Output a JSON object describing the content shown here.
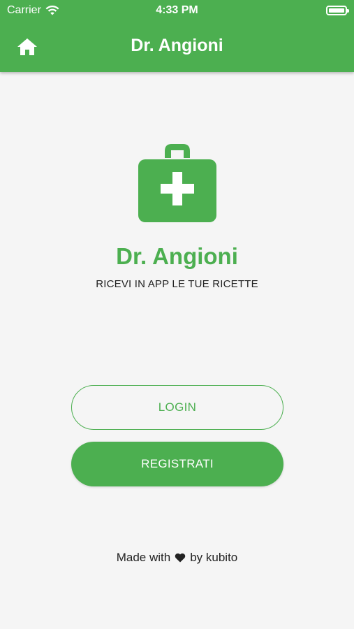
{
  "status_bar": {
    "carrier": "Carrier",
    "time": "4:33 PM"
  },
  "app_bar": {
    "title": "Dr. Angioni",
    "home_icon": "home-icon"
  },
  "hero": {
    "icon": "medical-kit-icon",
    "brand_name": "Dr. Angioni",
    "tagline": "RICEVI IN APP LE TUE RICETTE"
  },
  "actions": {
    "login_label": "LOGIN",
    "register_label": "REGISTRATI"
  },
  "footer": {
    "made_with": "Made with",
    "by": "by kubito",
    "icon": "heart-icon"
  },
  "colors": {
    "primary": "#4caf50",
    "background": "#f5f5f5",
    "text": "#222222"
  }
}
